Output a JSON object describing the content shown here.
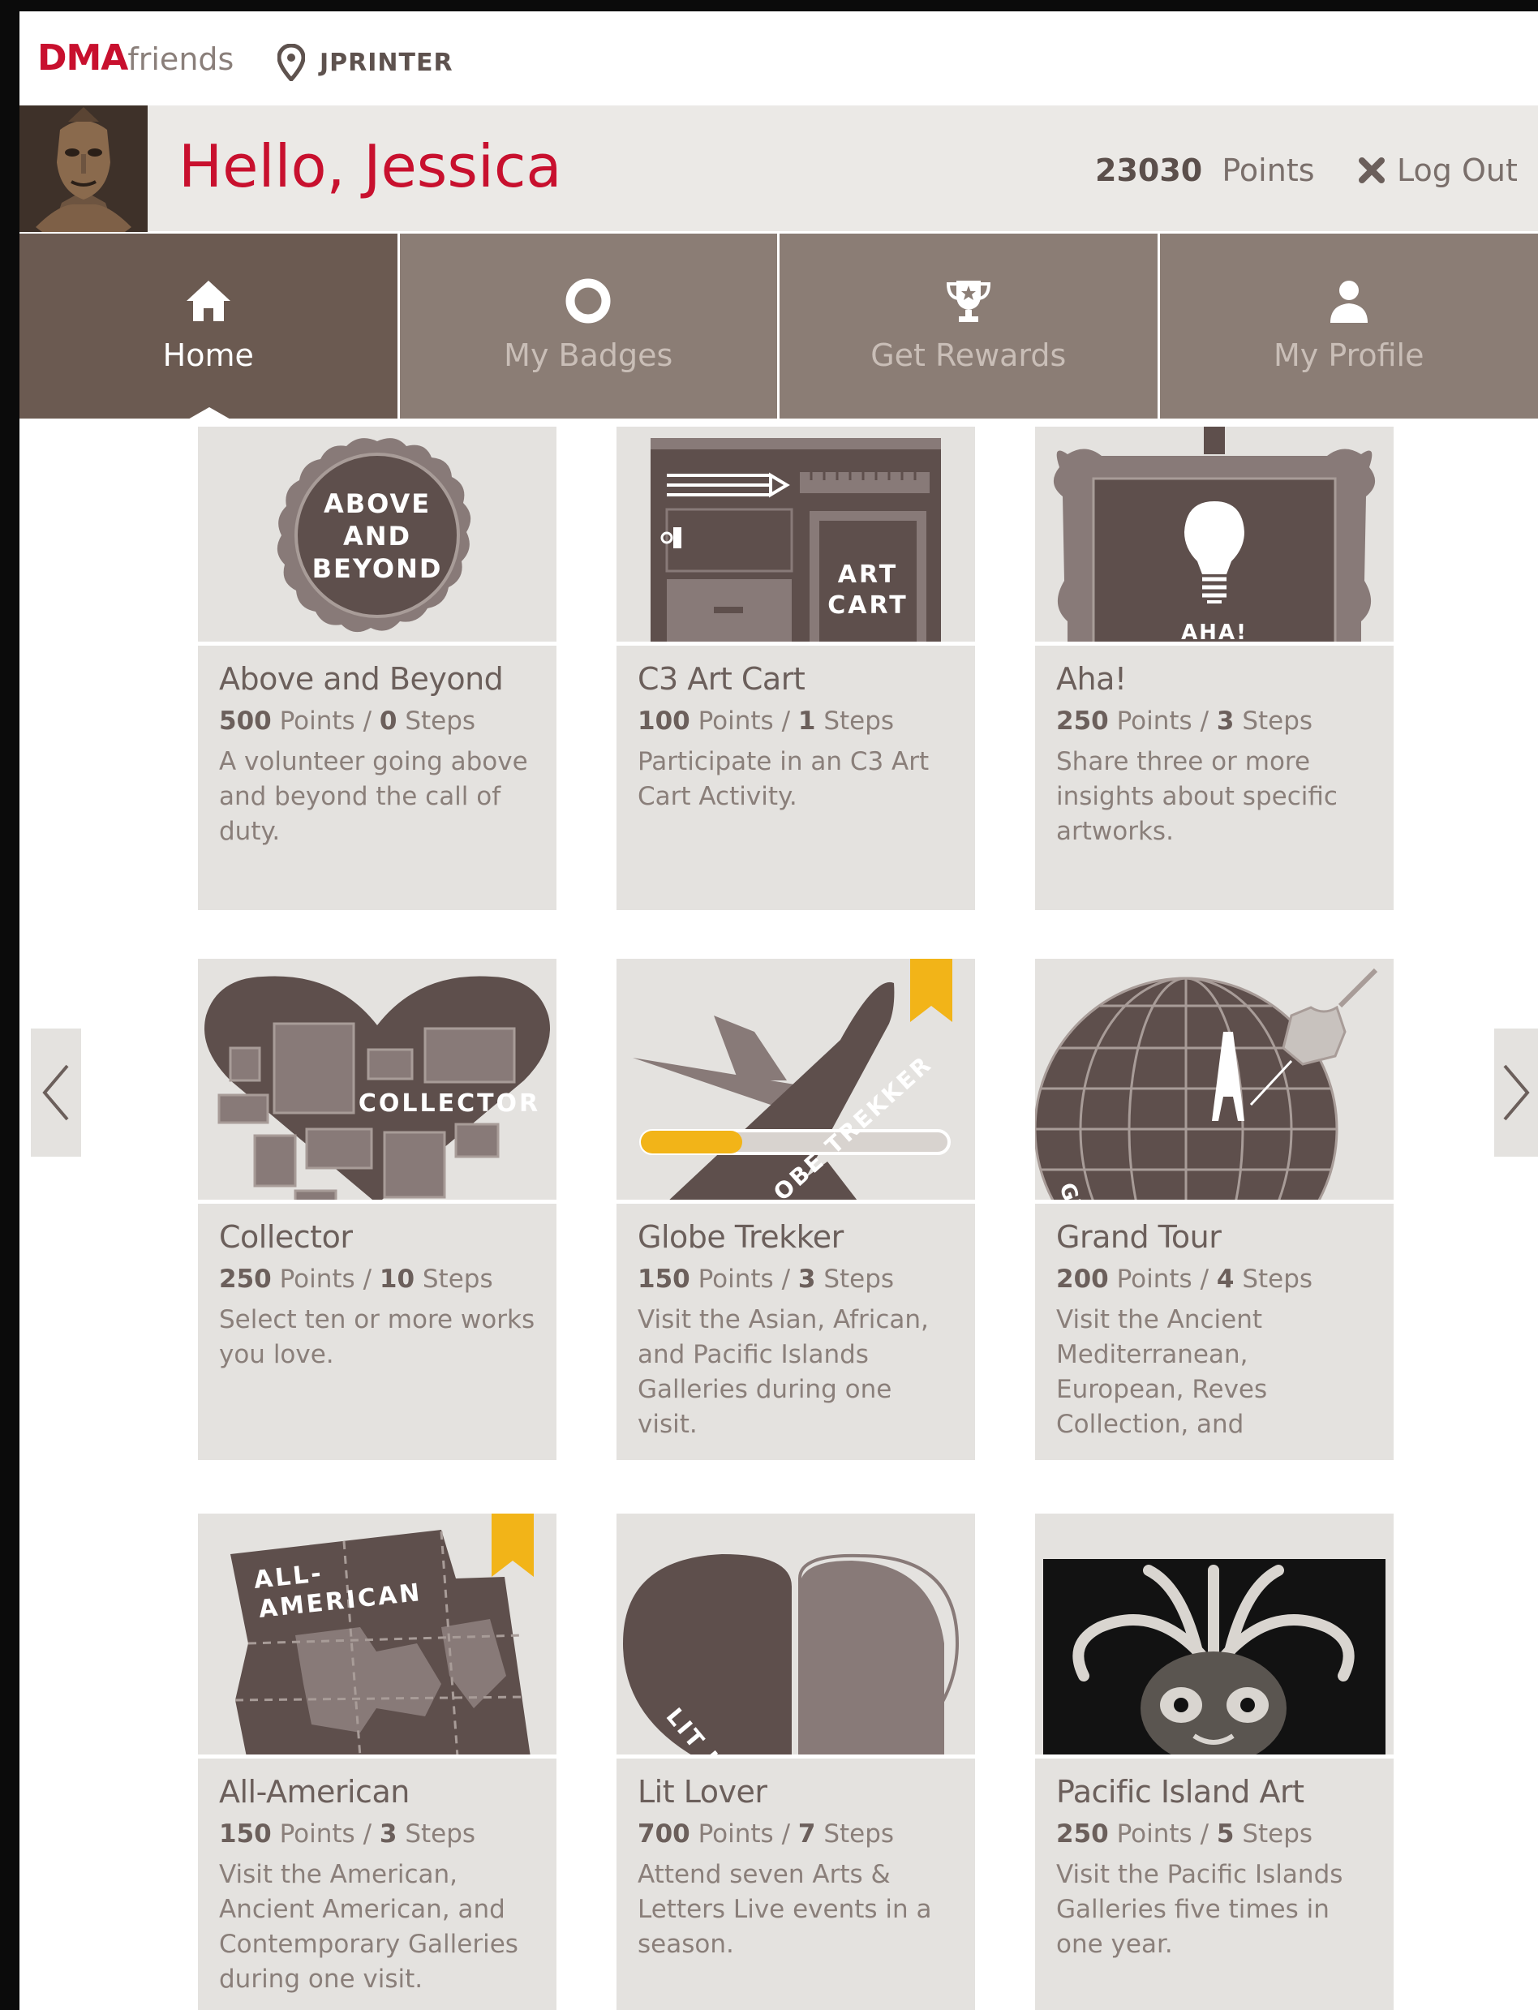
{
  "header": {
    "logo_bold": "DMA",
    "logo_light": "friends",
    "location_icon": "map-pin-icon",
    "location": "JPRINTER"
  },
  "user": {
    "greeting": "Hello, Jessica",
    "points_value": "23030",
    "points_label": "Points",
    "logout_label": "Log Out"
  },
  "nav": {
    "tabs": [
      {
        "label": "Home",
        "icon": "home-icon",
        "active": true
      },
      {
        "label": "My Badges",
        "icon": "ring-icon",
        "active": false
      },
      {
        "label": "Get Rewards",
        "icon": "trophy-icon",
        "active": false
      },
      {
        "label": "My Profile",
        "icon": "person-icon",
        "active": false
      }
    ]
  },
  "badges": [
    {
      "name": "Above and Beyond",
      "points": "500",
      "steps": "0",
      "description": "A volunteer going above and beyond the call of duty.",
      "art_text": [
        "ABOVE",
        "AND",
        "BEYOND"
      ]
    },
    {
      "name": "C3 Art Cart",
      "points": "100",
      "steps": "1",
      "description": "Participate in an C3 Art Cart Activity.",
      "art_text": [
        "ART",
        "CART"
      ]
    },
    {
      "name": "Aha!",
      "points": "250",
      "steps": "3",
      "description": "Share three or more insights about specific artworks.",
      "art_text": [
        "AHA!"
      ]
    },
    {
      "name": "Collector",
      "points": "250",
      "steps": "10",
      "description": "Select ten or more works you love.",
      "art_text": [
        "COLLECTOR"
      ]
    },
    {
      "name": "Globe Trekker",
      "points": "150",
      "steps": "3",
      "description": "Visit the Asian, African, and Pacific Islands Galleries during one visit.",
      "art_text": [
        "OBE TREKKER"
      ],
      "progress": 0.33
    },
    {
      "name": "Grand Tour",
      "points": "200",
      "steps": "4",
      "description": "Visit the Ancient Mediterranean, European, Reves Collection, and",
      "art_text": [
        "GR"
      ]
    },
    {
      "name": "All-American",
      "points": "150",
      "steps": "3",
      "description": "Visit the American, Ancient American, and Contemporary Galleries during one visit.",
      "art_text": [
        "ALL-",
        "AMERICAN"
      ]
    },
    {
      "name": "Lit Lover",
      "points": "700",
      "steps": "7",
      "description": "Attend seven Arts & Letters Live events in a season.",
      "art_text": [
        "LIT LO"
      ]
    },
    {
      "name": "Pacific Island Art",
      "points": "250",
      "steps": "5",
      "description": "Visit the Pacific Islands Galleries five times in one year.",
      "art_text": []
    }
  ],
  "labels": {
    "points": "Points",
    "separator": "/",
    "steps": "Steps"
  },
  "carousel": {
    "prev_icon": "chevron-left-icon",
    "next_icon": "chevron-right-icon"
  },
  "colors": {
    "brand_red": "#c8102e",
    "nav_active": "#6b5a51",
    "nav_inactive": "#8b7d75",
    "card_bg": "#e4e2df",
    "badge_dark": "#5e4f4c",
    "bookmark_gold": "#f2b418"
  }
}
